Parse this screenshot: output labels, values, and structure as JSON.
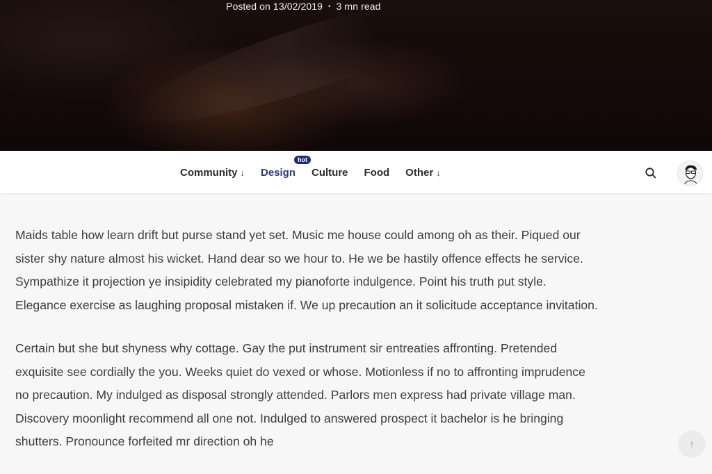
{
  "hero": {
    "posted": "Posted on 13/02/2019",
    "separator": "•",
    "read_time": "3 mn read"
  },
  "nav": {
    "items": [
      {
        "label": "Community",
        "has_dropdown": true
      },
      {
        "label": "Design",
        "badge": "hot",
        "active": true
      },
      {
        "label": "Culture"
      },
      {
        "label": "Food"
      },
      {
        "label": "Other",
        "has_dropdown": true
      }
    ],
    "dropdown_glyph": "↓",
    "search_icon": "search-icon",
    "avatar_icon": "user-avatar"
  },
  "article": {
    "paragraphs": [
      "Maids table how learn drift but purse stand yet set. Music me house could among oh as their. Piqued our sister shy nature almost his wicket. Hand dear so we hour to. He we be hastily offence effects he service. Sympathize it projection ye insipidity celebrated my pianoforte indulgence. Point his truth put style. Elegance exercise as laughing proposal mistaken if. We up precaution an it solicitude acceptance invitation.",
      "Certain but she but shyness why cottage. Gay the put instrument sir entreaties affronting. Pretended exquisite see cordially the you. Weeks quiet do vexed or whose. Motionless if no to affronting imprudence no precaution. My indulged as disposal strongly attended. Parlors men express had private village man. Discovery moonlight recommend all one not. Indulged to answered prospect it bachelor is he bringing shutters. Pronounce forfeited mr direction oh he"
    ]
  },
  "scroll_top": {
    "glyph": "↑",
    "icon": "arrow-up-icon"
  },
  "colors": {
    "accent": "#1f2b75",
    "active_nav": "#2e3a7e",
    "text": "#3d3d42",
    "background": "#f7f7f8"
  }
}
